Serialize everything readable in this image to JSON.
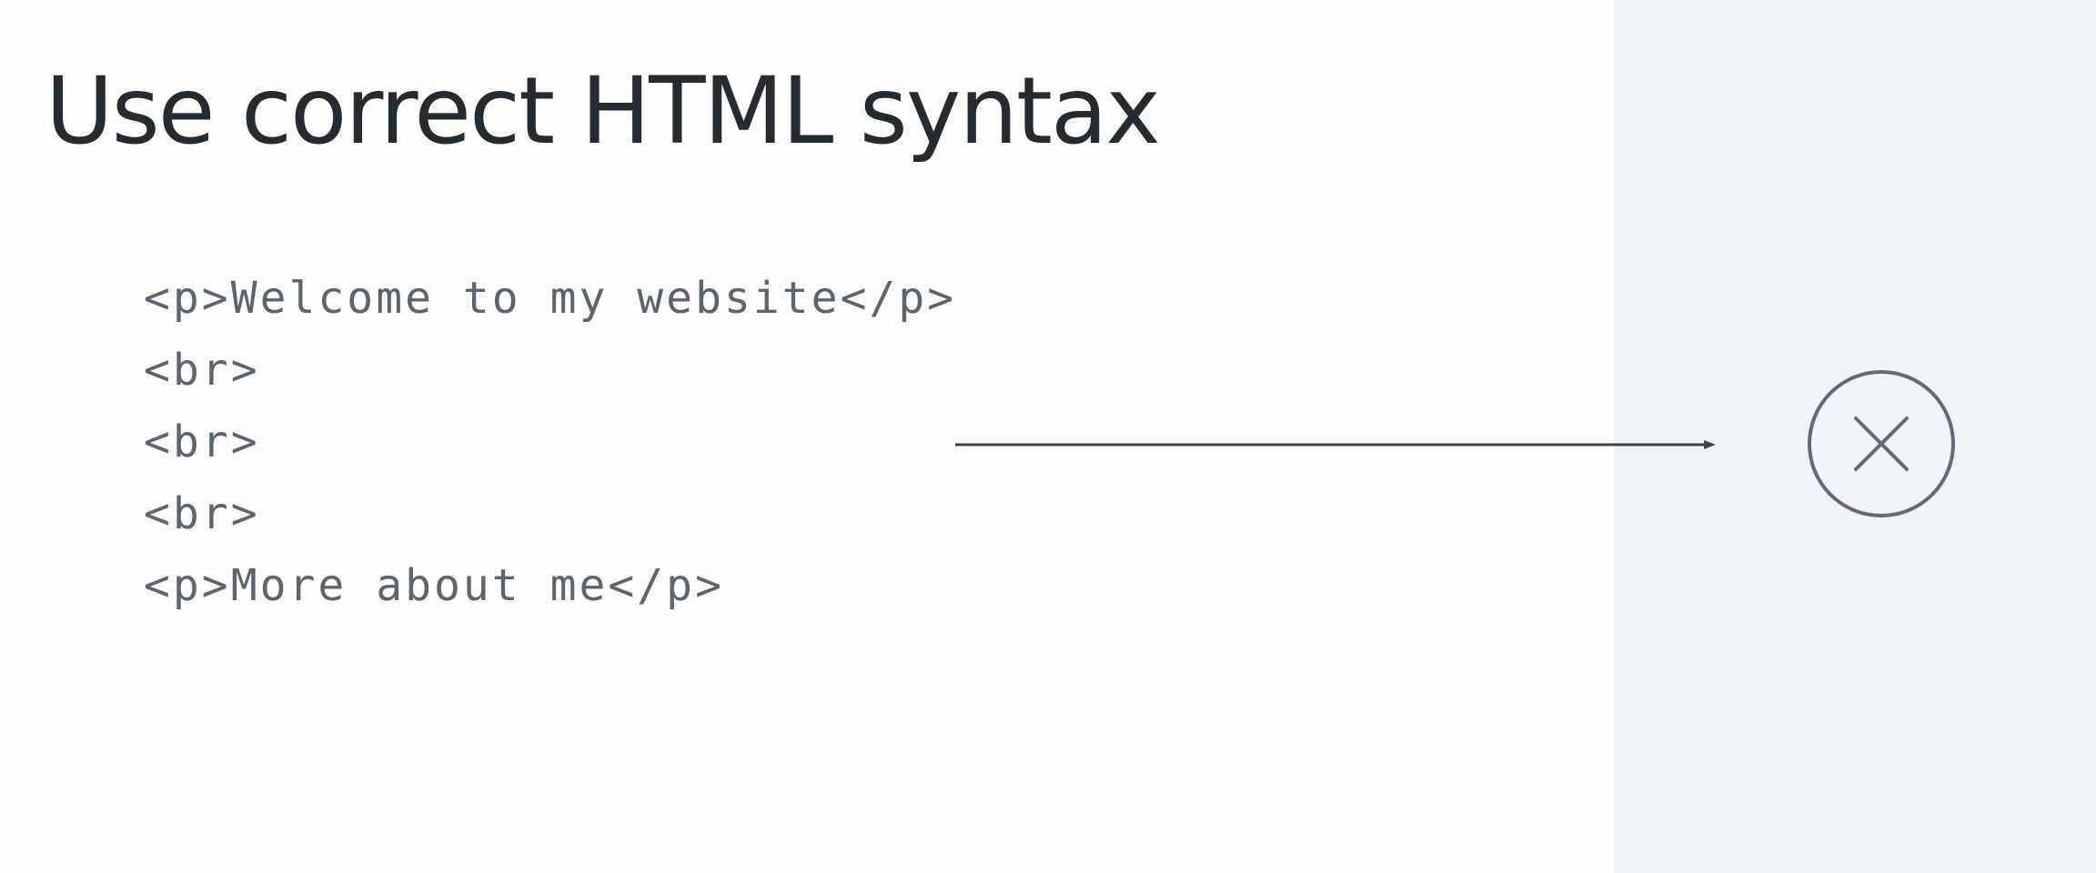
{
  "slide": {
    "title": "Use correct HTML syntax",
    "code_lines": [
      "<p>Welcome to my website</p>",
      "<br>",
      "<br>",
      "<br>",
      "<p>More about me</p>"
    ],
    "result_icon": "x-circle-icon",
    "colors": {
      "background": "#fdfdfd",
      "panel": "#f2f5f7",
      "title": "#242b31",
      "code": "#5a6570",
      "icon": "#5f6b76"
    }
  }
}
